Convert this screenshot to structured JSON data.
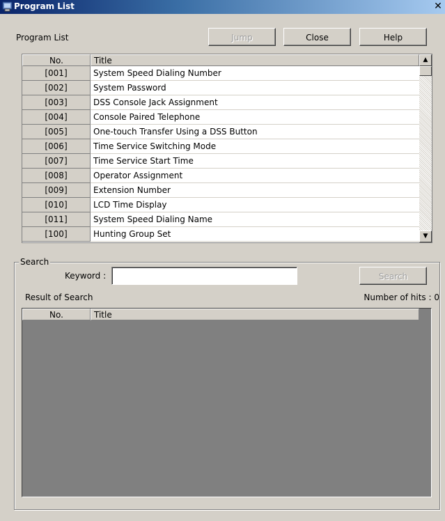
{
  "window": {
    "title": "Program List",
    "close_glyph": "✕"
  },
  "program_list": {
    "label": "Program List",
    "buttons": {
      "jump": "Jump",
      "close": "Close",
      "help": "Help"
    },
    "columns": {
      "no": "No.",
      "title": "Title"
    },
    "rows": [
      {
        "no": "[001]",
        "title": "System Speed Dialing Number"
      },
      {
        "no": "[002]",
        "title": "System Password"
      },
      {
        "no": "[003]",
        "title": "DSS Console Jack Assignment"
      },
      {
        "no": "[004]",
        "title": "Console Paired Telephone"
      },
      {
        "no": "[005]",
        "title": "One-touch Transfer Using a DSS Button"
      },
      {
        "no": "[006]",
        "title": "Time Service Switching Mode"
      },
      {
        "no": "[007]",
        "title": "Time Service Start Time"
      },
      {
        "no": "[008]",
        "title": "Operator Assignment"
      },
      {
        "no": "[009]",
        "title": "Extension Number"
      },
      {
        "no": "[010]",
        "title": "LCD Time Display"
      },
      {
        "no": "[011]",
        "title": "System Speed Dialing Name"
      },
      {
        "no": "[100]",
        "title": "Hunting Group Set"
      }
    ]
  },
  "search": {
    "group_label": "Search",
    "keyword_label": "Keyword :",
    "keyword_value": "",
    "search_button": "Search",
    "result_label": "Result of Search",
    "hits_label": "Number of hits : 0",
    "columns": {
      "no": "No.",
      "title": "Title"
    }
  },
  "icons": {
    "app": "program-list-app-icon",
    "scroll_up": "arrow-up-icon",
    "scroll_down": "arrow-down-icon"
  }
}
